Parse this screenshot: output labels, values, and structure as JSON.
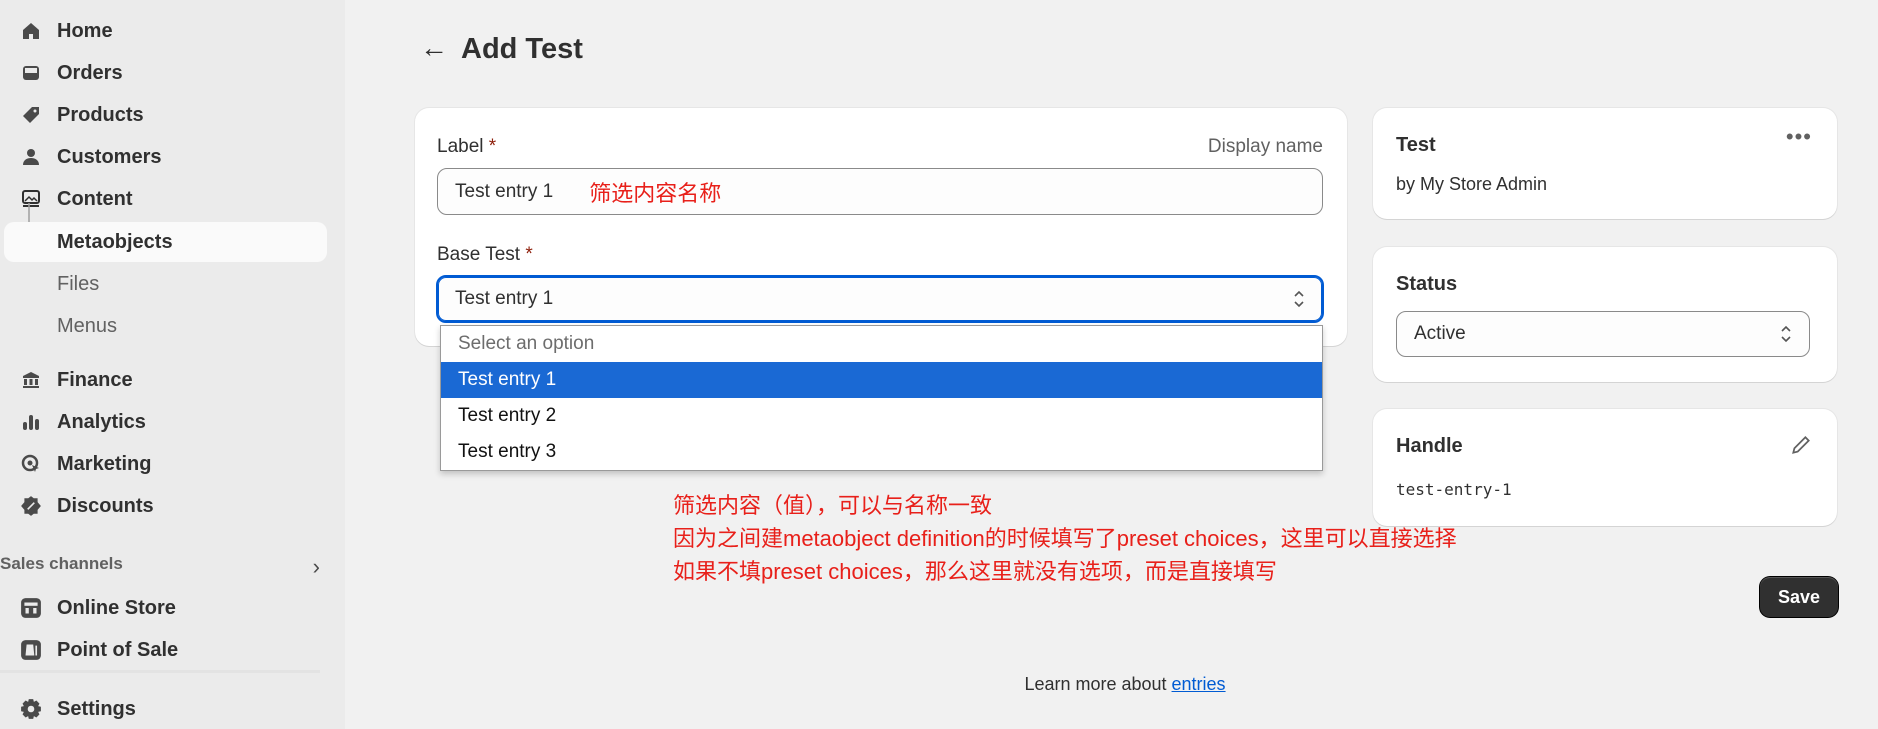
{
  "sidebar": {
    "items": [
      {
        "label": "Home",
        "icon": "home-icon"
      },
      {
        "label": "Orders",
        "icon": "inbox-icon"
      },
      {
        "label": "Products",
        "icon": "tag-icon"
      },
      {
        "label": "Customers",
        "icon": "person-icon"
      },
      {
        "label": "Content",
        "icon": "image-icon"
      },
      {
        "label": "Metaobjects",
        "active": true
      },
      {
        "label": "Files"
      },
      {
        "label": "Menus"
      },
      {
        "label": "Finance",
        "icon": "bank-icon"
      },
      {
        "label": "Analytics",
        "icon": "bar-chart-icon"
      },
      {
        "label": "Marketing",
        "icon": "target-icon"
      },
      {
        "label": "Discounts",
        "icon": "discount-icon"
      }
    ],
    "sales_channels_label": "Sales channels",
    "channels": [
      {
        "label": "Online Store",
        "icon": "store-icon"
      },
      {
        "label": "Point of Sale",
        "icon": "pos-icon"
      }
    ],
    "settings_label": "Settings"
  },
  "page": {
    "title": "Add Test"
  },
  "form": {
    "label_field": {
      "label": "Label",
      "required": "*",
      "hint": "Display name",
      "value": "Test entry 1"
    },
    "base_field": {
      "label": "Base Test",
      "required": "*",
      "value": "Test entry 1",
      "options": [
        "Select an option",
        "Test entry 1",
        "Test entry 2",
        "Test entry 3"
      ],
      "selected_index": 1
    }
  },
  "annotations": {
    "label_note": "筛选内容名称",
    "lines": [
      "筛选内容（值），可以与名称一致",
      "因为之间建metaobject definition的时候填写了preset choices，这里可以直接选择",
      "如果不填preset choices，那么这里就没有选项，而是直接填写"
    ],
    "color": "#e8201a"
  },
  "side": {
    "definition": {
      "title": "Test",
      "subtitle": "by My Store Admin"
    },
    "status": {
      "title": "Status",
      "value": "Active"
    },
    "handle": {
      "title": "Handle",
      "value": "test-entry-1"
    }
  },
  "save_label": "Save",
  "footer": {
    "text": "Learn more about ",
    "link": "entries"
  },
  "colors": {
    "accent": "#005bd3",
    "selected_option": "#1a69d4",
    "primary_button": "#303030"
  }
}
